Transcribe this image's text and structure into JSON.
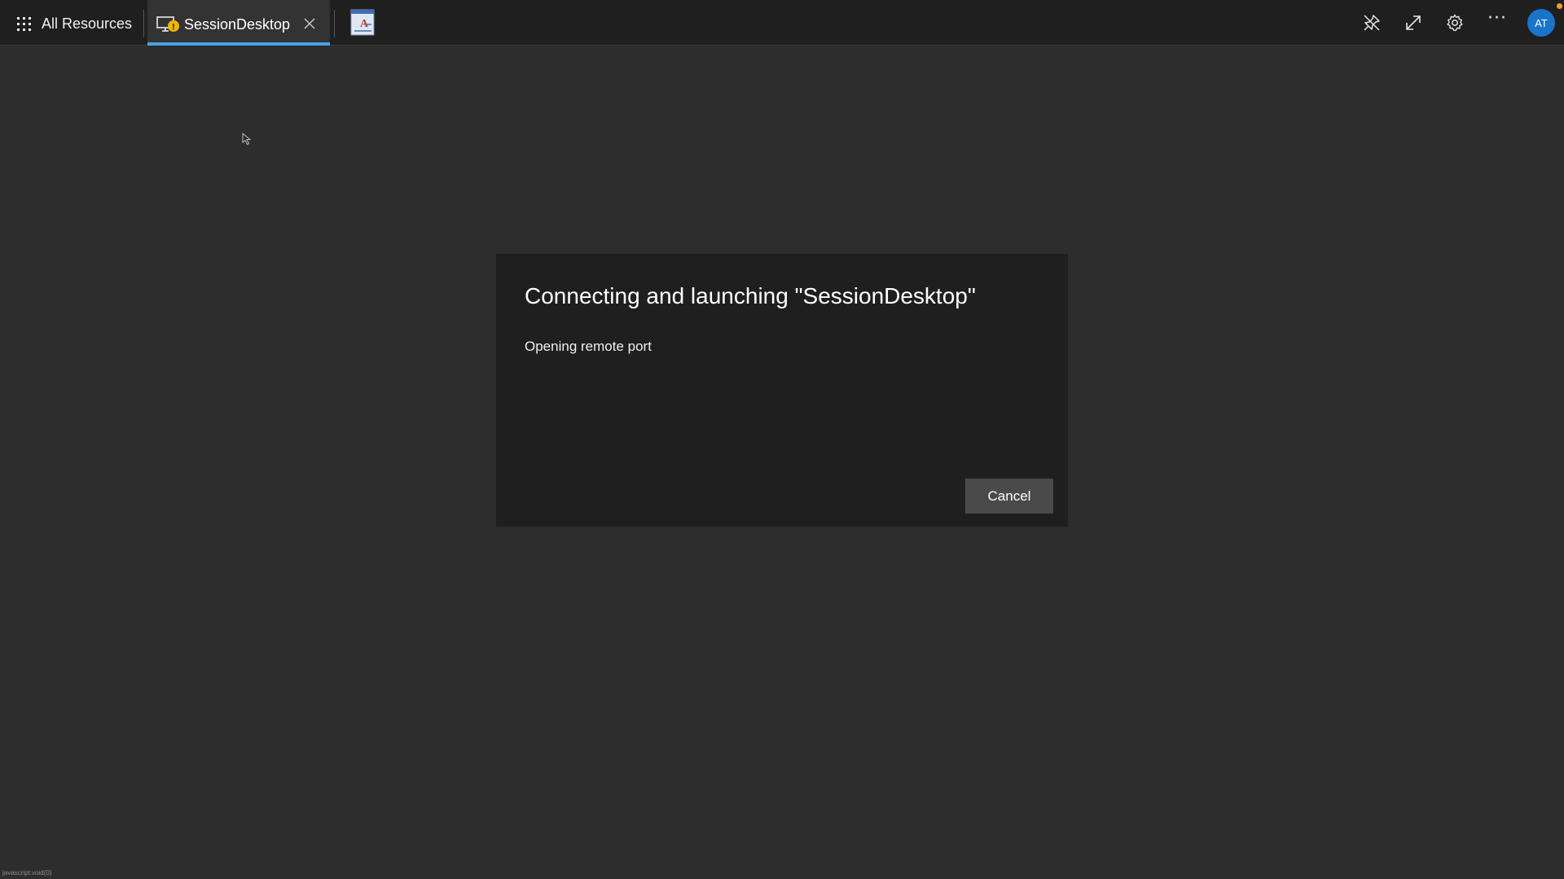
{
  "topbar": {
    "all_resources_label": "All Resources",
    "tab": {
      "label": "SessionDesktop",
      "status_badge": "!"
    },
    "avatar_initials": "AT",
    "more_label": "···",
    "icons": [
      "apps-grid-icon",
      "remote-desktop-icon",
      "close-icon",
      "app-thumbnail-icon",
      "unpin-icon",
      "fullscreen-icon",
      "gear-icon",
      "more-icon"
    ],
    "colors": {
      "accent": "#4aa0e6",
      "avatar": "#1a74c9",
      "warning_badge": "#f4b400",
      "notification_dot": "#f29f2f"
    }
  },
  "dialog": {
    "title": "Connecting and launching \"SessionDesktop\"",
    "status": "Opening remote port",
    "cancel_label": "Cancel"
  },
  "statusbar": {
    "text": "javascript:void(0)"
  }
}
